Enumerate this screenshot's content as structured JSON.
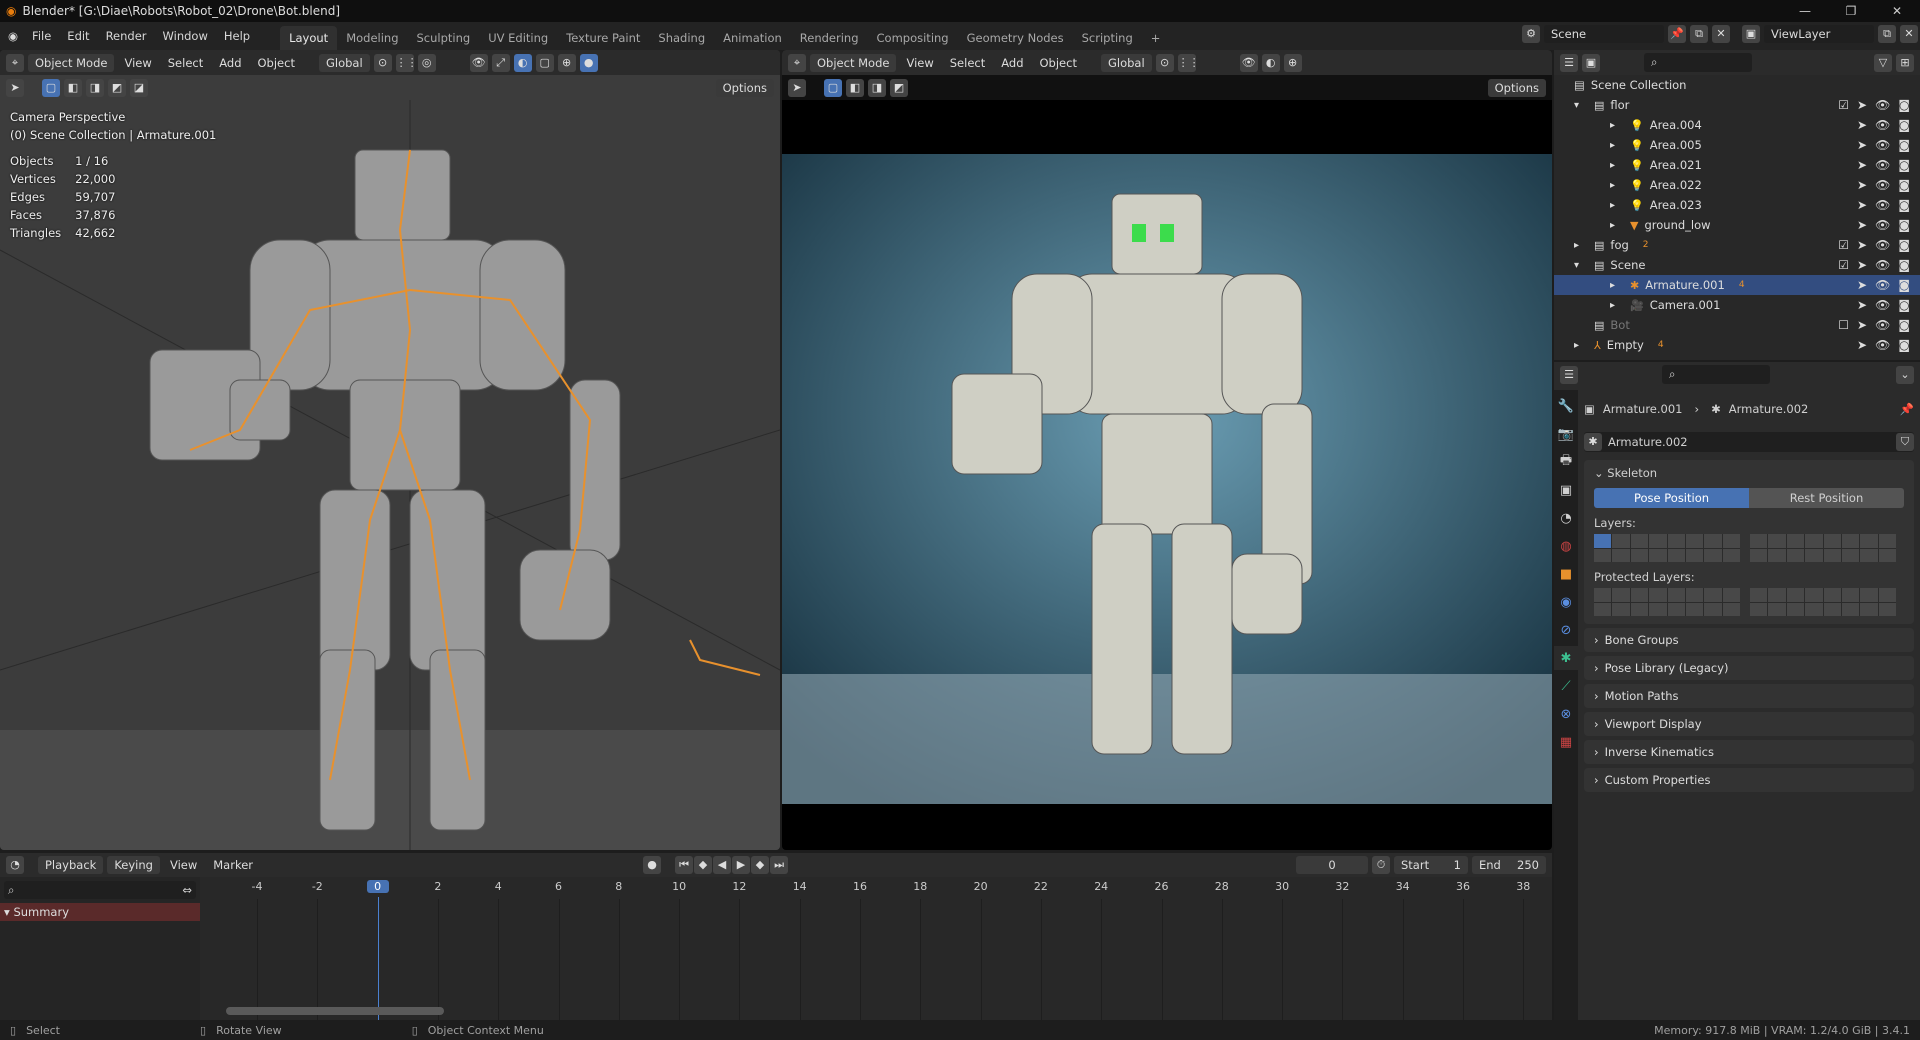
{
  "window": {
    "title": "Blender* [G:\\Diae\\Robots\\Robot_02\\Drone\\Bot.blend]",
    "min": "—",
    "max": "❐",
    "close": "✕"
  },
  "menu": [
    "File",
    "Edit",
    "Render",
    "Window",
    "Help"
  ],
  "workspaces": [
    "Layout",
    "Modeling",
    "Sculpting",
    "UV Editing",
    "Texture Paint",
    "Shading",
    "Animation",
    "Rendering",
    "Compositing",
    "Geometry Nodes",
    "Scripting",
    "+"
  ],
  "scene": {
    "name": "Scene",
    "view_layer": "ViewLayer"
  },
  "viewport_header": {
    "mode": "Object Mode",
    "view": "View",
    "select": "Select",
    "add": "Add",
    "object": "Object",
    "orientation": "Global",
    "options": "Options"
  },
  "viewport_left": {
    "camera": "Camera Perspective",
    "collection": "(0) Scene Collection | Armature.001",
    "stats": [
      {
        "label": "Objects",
        "value": "1 / 16"
      },
      {
        "label": "Vertices",
        "value": "22,000"
      },
      {
        "label": "Edges",
        "value": "59,707"
      },
      {
        "label": "Faces",
        "value": "37,876"
      },
      {
        "label": "Triangles",
        "value": "42,662"
      }
    ]
  },
  "outliner": {
    "root": "Scene Collection",
    "rows": [
      {
        "name": "flor",
        "depth": 1,
        "type": "collection",
        "expanded": true,
        "check": true
      },
      {
        "name": "Area.004",
        "depth": 2,
        "type": "light"
      },
      {
        "name": "Area.005",
        "depth": 2,
        "type": "light"
      },
      {
        "name": "Area.021",
        "depth": 2,
        "type": "light"
      },
      {
        "name": "Area.022",
        "depth": 2,
        "type": "light"
      },
      {
        "name": "Area.023",
        "depth": 2,
        "type": "light"
      },
      {
        "name": "ground_low",
        "depth": 2,
        "type": "mesh"
      },
      {
        "name": "fog",
        "depth": 1,
        "type": "collection",
        "check": true,
        "badge": "2"
      },
      {
        "name": "Scene",
        "depth": 1,
        "type": "collection",
        "expanded": true,
        "check": true
      },
      {
        "name": "Armature.001",
        "depth": 2,
        "type": "armature",
        "selected": true,
        "badge": "4"
      },
      {
        "name": "Camera.001",
        "depth": 2,
        "type": "camera"
      },
      {
        "name": "Bot",
        "depth": 1,
        "type": "collection",
        "disabled": true
      },
      {
        "name": "Empty",
        "depth": 1,
        "type": "empty",
        "badge": "4"
      }
    ]
  },
  "properties": {
    "breadcrumb_object": "Armature.001",
    "breadcrumb_data": "Armature.002",
    "data_name": "Armature.002",
    "skeleton": "Skeleton",
    "pose_position": "Pose Position",
    "rest_position": "Rest Position",
    "layers": "Layers:",
    "protected_layers": "Protected Layers:",
    "panels": [
      "Bone Groups",
      "Pose Library (Legacy)",
      "Motion Paths",
      "Viewport Display",
      "Inverse Kinematics",
      "Custom Properties"
    ]
  },
  "timeline": {
    "playback": "Playback",
    "keying": "Keying",
    "view": "View",
    "marker": "Marker",
    "current_frame": "0",
    "start_label": "Start",
    "start": "1",
    "end_label": "End",
    "end": "250",
    "summary": "Summary",
    "ticks": [
      "-4",
      "-2",
      "0",
      "2",
      "4",
      "6",
      "8",
      "10",
      "12",
      "14",
      "16",
      "18",
      "20",
      "22",
      "24",
      "26",
      "28",
      "30",
      "32",
      "34",
      "36",
      "38"
    ]
  },
  "status": {
    "select": "Select",
    "rotate": "Rotate View",
    "context": "Object Context Menu",
    "info": "Memory: 917.8 MiB | VRAM: 1.2/4.0 GiB | 3.4.1"
  },
  "colors": {
    "accent": "#4772b3",
    "selected_row": "#334d80",
    "summary": "#5a2a2a"
  }
}
